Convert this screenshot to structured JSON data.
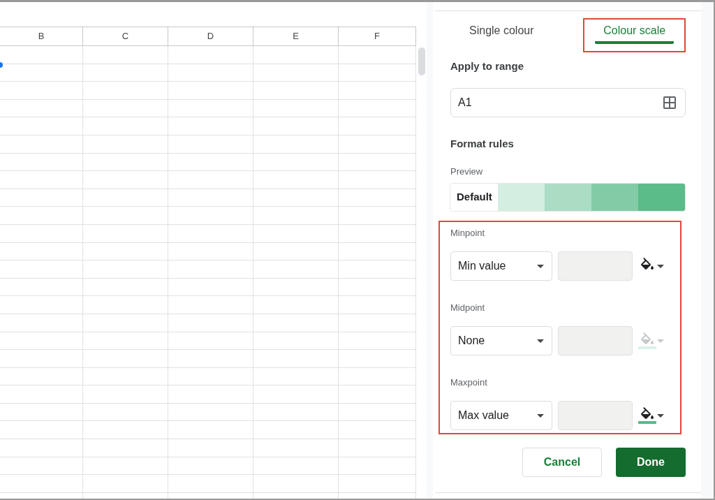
{
  "sheet": {
    "column_headers": [
      "B",
      "C",
      "D",
      "E",
      "F"
    ]
  },
  "panel": {
    "tabs": [
      {
        "label": "Single colour",
        "selected": false,
        "highlighted": false
      },
      {
        "label": "Colour scale",
        "selected": true,
        "highlighted": true
      }
    ],
    "apply_to_range": {
      "label": "Apply to range",
      "value": "A1"
    },
    "format_rules": {
      "heading": "Format rules",
      "preview": {
        "label": "Preview",
        "default_label": "Default",
        "swatches": [
          {
            "color": "#d4eee1"
          },
          {
            "color": "#abdcc4"
          },
          {
            "color": "#83cba6"
          },
          {
            "color": "#5bbb89"
          }
        ]
      },
      "scale_points": {
        "highlighted": true,
        "points": [
          {
            "label": "Minpoint",
            "type": "Min value",
            "disabled": false
          },
          {
            "label": "Midpoint",
            "type": "None",
            "disabled": true,
            "color": "#dbf1e7"
          },
          {
            "label": "Maxpoint",
            "type": "Max value",
            "disabled": false,
            "color": "#57bb8a"
          }
        ]
      }
    },
    "buttons": [
      {
        "label": "Cancel",
        "kind": "secondary"
      },
      {
        "label": "Done",
        "kind": "primary"
      }
    ]
  }
}
